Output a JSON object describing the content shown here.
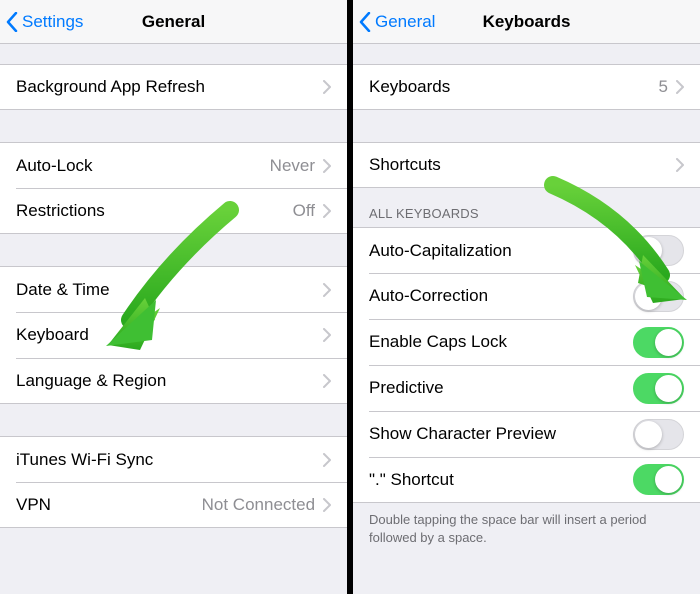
{
  "left": {
    "nav": {
      "back": "Settings",
      "title": "General"
    },
    "groups": [
      {
        "cells": [
          {
            "label": "Background App Refresh",
            "disclosure": true
          }
        ]
      },
      {
        "cells": [
          {
            "label": "Auto-Lock",
            "detail": "Never",
            "disclosure": true
          },
          {
            "label": "Restrictions",
            "detail": "Off",
            "disclosure": true
          }
        ]
      },
      {
        "cells": [
          {
            "label": "Date & Time",
            "disclosure": true
          },
          {
            "label": "Keyboard",
            "disclosure": true
          },
          {
            "label": "Language & Region",
            "disclosure": true
          }
        ]
      },
      {
        "cells": [
          {
            "label": "iTunes Wi-Fi Sync",
            "disclosure": true
          },
          {
            "label": "VPN",
            "detail": "Not Connected",
            "disclosure": true
          }
        ]
      }
    ]
  },
  "right": {
    "nav": {
      "back": "General",
      "title": "Keyboards"
    },
    "top": [
      {
        "label": "Keyboards",
        "detail": "5",
        "disclosure": true
      }
    ],
    "shortcuts": [
      {
        "label": "Shortcuts",
        "disclosure": true
      }
    ],
    "allKeyboardsHeader": "ALL KEYBOARDS",
    "toggles": [
      {
        "id": "auto-capitalization",
        "label": "Auto-Capitalization",
        "on": false
      },
      {
        "id": "auto-correction",
        "label": "Auto-Correction",
        "on": false
      },
      {
        "id": "enable-caps-lock",
        "label": "Enable Caps Lock",
        "on": true
      },
      {
        "id": "predictive",
        "label": "Predictive",
        "on": true
      },
      {
        "id": "show-character-preview",
        "label": "Show Character Preview",
        "on": false
      },
      {
        "id": "period-shortcut",
        "label": "\".\" Shortcut",
        "on": true
      }
    ],
    "footer": "Double tapping the space bar will insert a period followed by a space."
  },
  "colors": {
    "link": "#007aff",
    "switchOn": "#4cd964",
    "arrow": "#3fbf33"
  }
}
